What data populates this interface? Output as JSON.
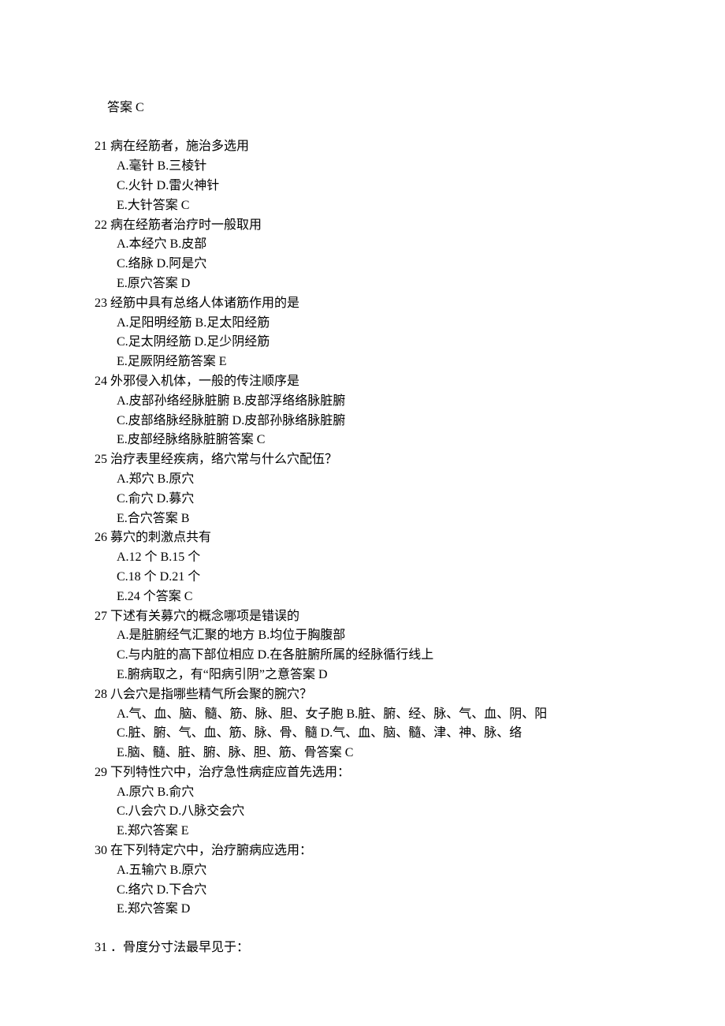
{
  "intro": {
    "answer_label": "答案",
    "answer_value": "C"
  },
  "questions": [
    {
      "num": "21",
      "stem": "病在经筋者，施治多选用",
      "options": [
        "A.毫针 B.三棱针",
        "C.火针 D.雷火神针",
        "E.大针答案 C"
      ]
    },
    {
      "num": "22",
      "stem": "病在经筋者治疗时一般取用",
      "options": [
        "A.本经穴 B.皮部",
        "C.络脉 D.阿是穴",
        "E.原穴答案 D"
      ]
    },
    {
      "num": "23",
      "stem": "经筋中具有总络人体诸筋作用的是",
      "options": [
        "A.足阳明经筋 B.足太阳经筋",
        "C.足太阴经筋 D.足少阴经筋",
        "E.足厥阴经筋答案 E"
      ]
    },
    {
      "num": "24",
      "stem": "外邪侵入机体，一般的传注顺序是",
      "options": [
        "A.皮部孙络经脉脏腑 B.皮部浮络络脉脏腑",
        "C.皮部络脉经脉脏腑 D.皮部孙脉络脉脏腑",
        "E.皮部经脉络脉脏腑答案 C"
      ]
    },
    {
      "num": "25",
      "stem": "治疗表里经疾病，络穴常与什么穴配伍？",
      "options": [
        "A.郑穴 B.原穴",
        "C.俞穴 D.募穴",
        "E.合穴答案 B"
      ]
    },
    {
      "num": "26",
      "stem": "募穴的刺激点共有",
      "options": [
        "A.12 个 B.15 个",
        "C.18 个 D.21 个",
        "E.24 个答案 C"
      ]
    },
    {
      "num": "27",
      "stem": "下述有关募穴的概念哪项是错误的",
      "options": [
        "A.是脏腑经气汇聚的地方 B.均位于胸腹部",
        "C.与内脏的高下部位相应 D.在各脏腑所属的经脉循行线上",
        "E.腑病取之，有“阳病引阴”之意答案 D"
      ]
    },
    {
      "num": "28",
      "stem": "八会穴是指哪些精气所会聚的腕穴？",
      "options": [
        "A.气、血、脑、髓、筋、脉、胆、女子胞 B.脏、腑、经、脉、气、血、阴、阳",
        "C.脏、腑、气、血、筋、脉、骨、髓 D.气、血、脑、髓、津、神、脉、络",
        "E.脑、髓、脏、腑、脉、胆、筋、骨答案 C"
      ]
    },
    {
      "num": "29",
      "stem": "下列特性穴中，治疗急性病症应首先选用：",
      "options": [
        "A.原穴 B.俞穴",
        "C.八会穴 D.八脉交会穴",
        "E.郑穴答案 E"
      ]
    },
    {
      "num": "30",
      "stem": "在下列特定穴中，治疗腑病应选用：",
      "options": [
        "A.五输穴 B.原穴",
        "C.络穴 D.下合穴",
        "E.郑穴答案 D"
      ]
    }
  ],
  "spaced_question": {
    "num": "31",
    "stem": "．骨度分寸法最早见于："
  }
}
